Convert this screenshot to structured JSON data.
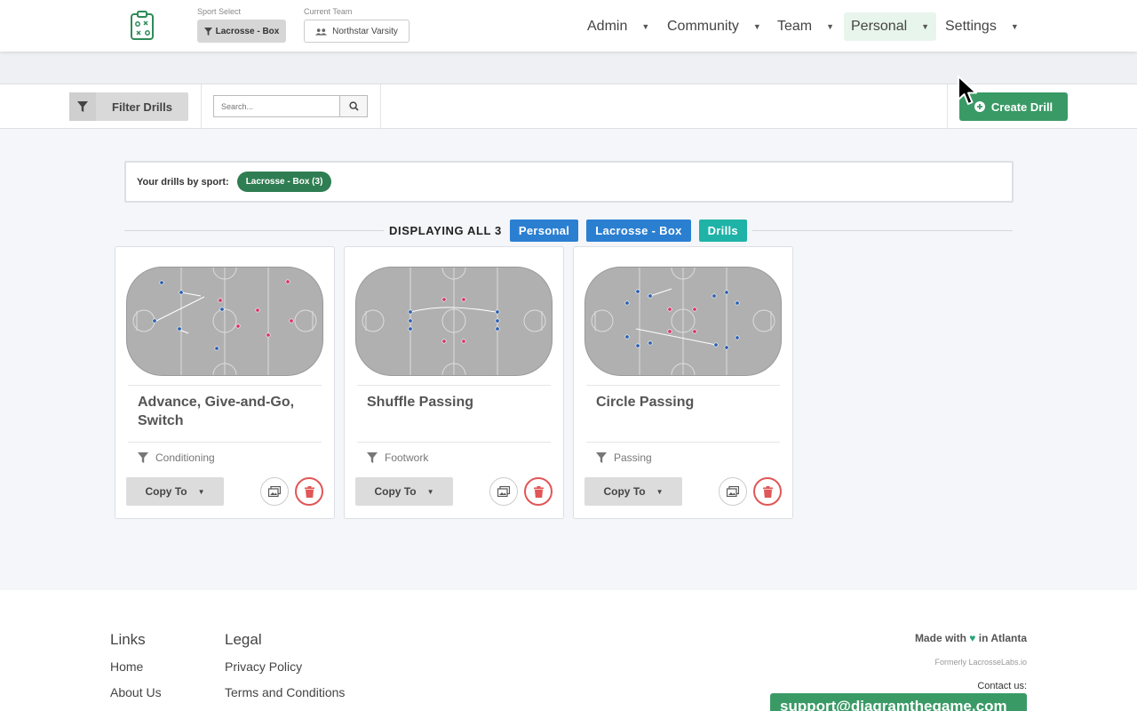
{
  "nav": {
    "sport_label": "Sport Select",
    "sport_value": "Lacrosse - Box",
    "team_label": "Current Team",
    "team_value": "Northstar Varsity",
    "menus": [
      {
        "label": "Admin",
        "active": false
      },
      {
        "label": "Community",
        "active": false
      },
      {
        "label": "Team",
        "active": false
      },
      {
        "label": "Personal",
        "active": true
      },
      {
        "label": "Settings",
        "active": false
      }
    ]
  },
  "toolbar": {
    "filter_label": "Filter Drills",
    "search_placeholder": "Search...",
    "create_label": "Create Drill"
  },
  "summary": {
    "label": "Your drills by sport:",
    "pill": "Lacrosse - Box (3)"
  },
  "display": {
    "text": "DISPLAYING ALL 3",
    "tags": [
      {
        "label": "Personal",
        "color": "#2b7fd1"
      },
      {
        "label": "Lacrosse - Box",
        "color": "#2b7fd1"
      },
      {
        "label": "Drills",
        "color": "#1fb3a8"
      }
    ]
  },
  "cards": [
    {
      "title": "Advance, Give-and-Go, Switch",
      "category": "Conditioning",
      "copy_label": "Copy To"
    },
    {
      "title": "Shuffle Passing",
      "category": "Footwork",
      "copy_label": "Copy To"
    },
    {
      "title": "Circle Passing",
      "category": "Passing",
      "copy_label": "Copy To"
    }
  ],
  "footer": {
    "links_heading": "Links",
    "links": [
      "Home",
      "About Us"
    ],
    "legal_heading": "Legal",
    "legal": [
      "Privacy Policy",
      "Terms and Conditions"
    ],
    "made_prefix": "Made with",
    "made_heart": "♥",
    "made_suffix": "in Atlanta",
    "formerly": "Formerly LacrosseLabs.io",
    "contact": "Contact us:",
    "support": "support@diagramthegame.com"
  },
  "colors": {
    "brand_green": "#3a9a66",
    "dark_green": "#2f7d52",
    "team_blue": "#2b5fb0",
    "team_red": "#d6356a",
    "danger": "#e15656",
    "rink_gray": "#b0b0b0"
  }
}
